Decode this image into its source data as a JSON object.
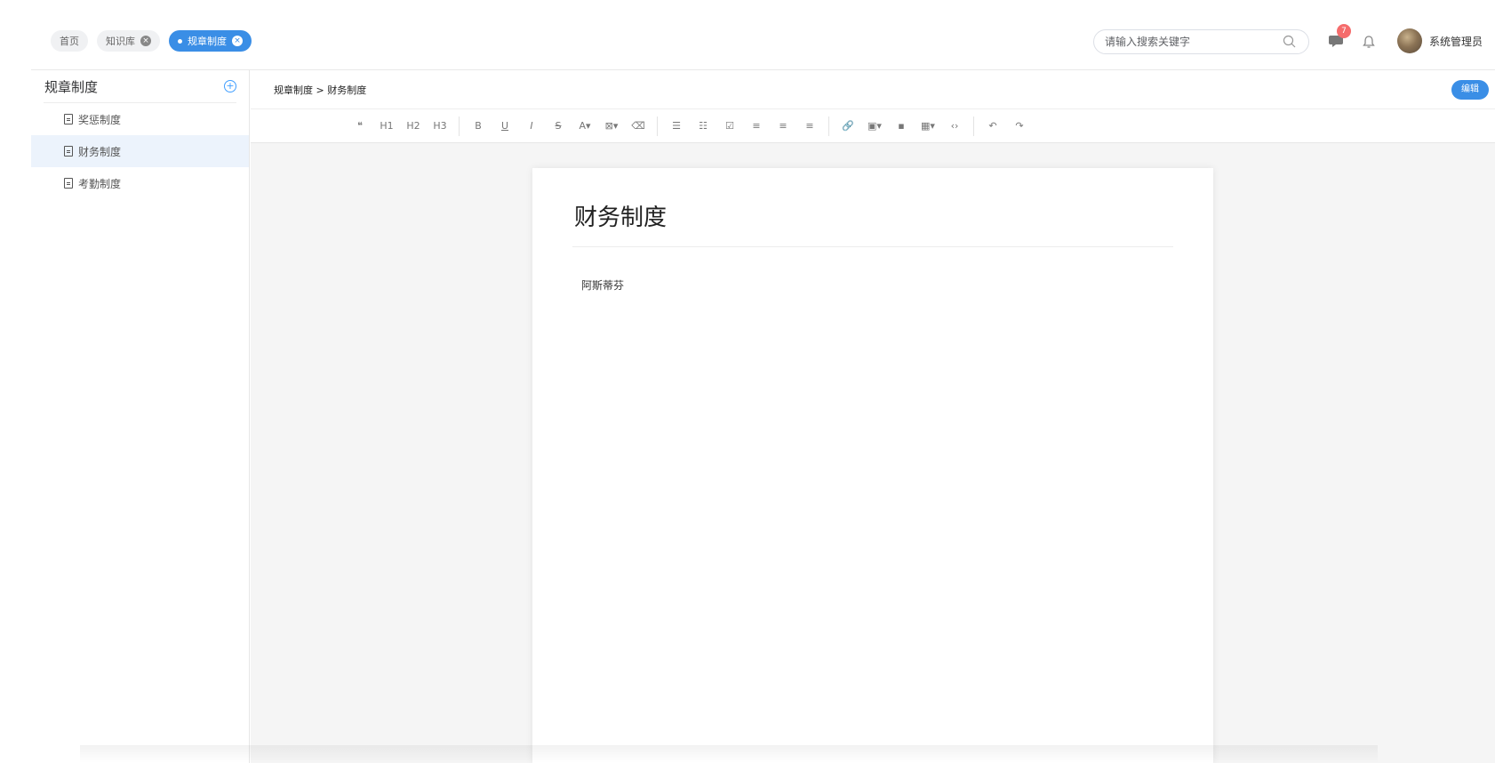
{
  "tabs": [
    {
      "label": "首页",
      "closable": false,
      "active": false
    },
    {
      "label": "知识库",
      "closable": true,
      "active": false
    },
    {
      "label": "规章制度",
      "closable": true,
      "active": true
    }
  ],
  "search": {
    "placeholder": "请输入搜索关键字"
  },
  "notifications": {
    "count": "7"
  },
  "user": {
    "name": "系统管理员"
  },
  "sidebar": {
    "title": "规章制度",
    "items": [
      {
        "label": "奖惩制度"
      },
      {
        "label": "财务制度"
      },
      {
        "label": "考勤制度"
      }
    ]
  },
  "breadcrumb": {
    "text": "规章制度 > 财务制度"
  },
  "edit_label": "编辑",
  "toolbar": {
    "quote": "❝",
    "h1": "H1",
    "h2": "H2",
    "h3": "H3",
    "bold": "B",
    "underline": "U",
    "italic": "I",
    "strike": "S",
    "font_color": "A▾",
    "bg_color": "⊠▾",
    "clear_format": "⌫",
    "bullet_list": "☰",
    "ordered_list": "☷",
    "todo": "☑",
    "align_left": "≡",
    "align_center": "≡",
    "align_right": "≡",
    "link": "🔗",
    "image": "▣▾",
    "video": "▪",
    "table": "▦▾",
    "code": "‹›",
    "undo": "↶",
    "redo": "↷"
  },
  "document": {
    "title": "财务制度",
    "body": "阿斯蒂芬"
  },
  "colors": {
    "accent": "#3a8ee6",
    "badge": "#f56c6c"
  }
}
